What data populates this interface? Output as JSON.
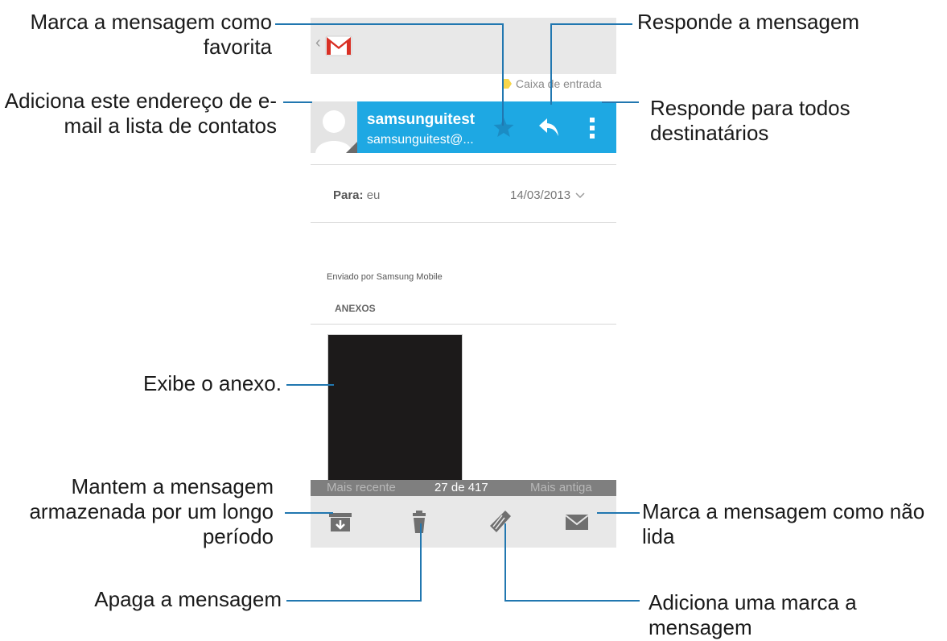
{
  "phone": {
    "label": "Caixa de entrada",
    "sender_name": "samsunguitest",
    "sender_email": "samsunguitest@...",
    "to_label": "Para:",
    "to_value": "eu",
    "date": "14/03/2013",
    "signature": "Enviado por Samsung Mobile",
    "attachments_heading": "ANEXOS",
    "nav": {
      "newer": "Mais recente",
      "position": "27 de 417",
      "older": "Mais antiga"
    },
    "colors": {
      "accent": "#1ea8e3",
      "bars": "#e8e8e8",
      "nav": "#7f7f7f",
      "callout_line": "#2177b0"
    }
  },
  "callouts": {
    "favorite": "Marca a mensagem como favorita",
    "add_contact": "Adiciona este endereço de e-mail a lista de contatos",
    "view_attachment": "Exibe o anexo.",
    "archive": "Mantem a mensagem armazenada por um longo período",
    "delete": "Apaga a mensagem",
    "reply": "Responde a mensagem",
    "reply_all": "Responde para todos destinatários",
    "mark_unread": "Marca a mensagem como não lida",
    "add_label": "Adiciona uma marca a mensagem"
  }
}
